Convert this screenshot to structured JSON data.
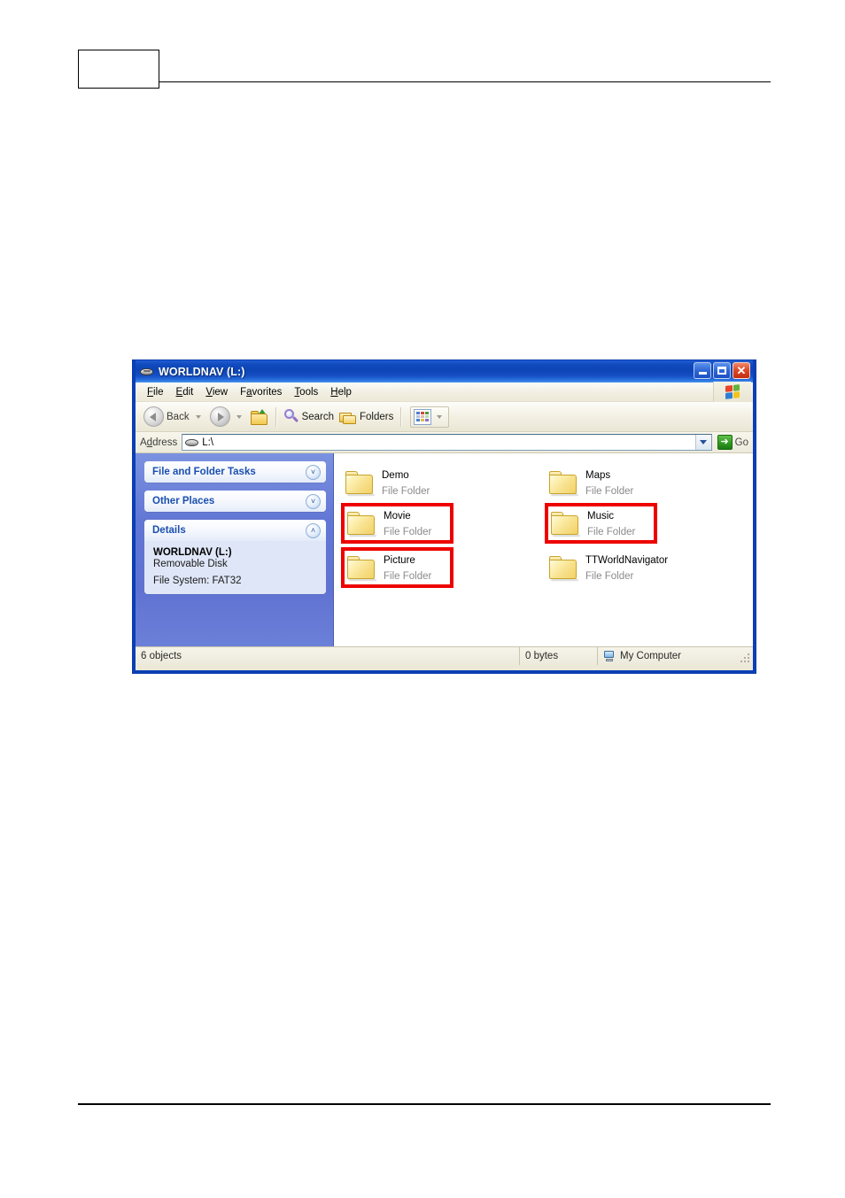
{
  "window": {
    "title": "WORLDNAV (L:)",
    "title_icon": "removable-drive-icon",
    "controls": {
      "minimize": "minimize-button",
      "maximize": "maximize-button",
      "close": "✕"
    }
  },
  "menubar": {
    "items": [
      {
        "label": "File",
        "accel": "F",
        "rest": "ile",
        "pre": ""
      },
      {
        "label": "Edit",
        "accel": "E",
        "rest": "dit",
        "pre": ""
      },
      {
        "label": "View",
        "accel": "V",
        "rest": "iew",
        "pre": ""
      },
      {
        "label": "Favorites",
        "accel": "a",
        "rest": "vorites",
        "pre": "F"
      },
      {
        "label": "Tools",
        "accel": "T",
        "rest": "ools",
        "pre": ""
      },
      {
        "label": "Help",
        "accel": "H",
        "rest": "elp",
        "pre": ""
      }
    ]
  },
  "toolbar": {
    "back_label": "Back",
    "forward_label": "",
    "up_label": "",
    "search_label": "Search",
    "folders_label": "Folders",
    "views_label": ""
  },
  "addressbar": {
    "label": "Address",
    "value": "L:\\",
    "go_label": "Go",
    "go_glyph": "➜"
  },
  "sidebar": {
    "panels": [
      {
        "title": "File and Folder Tasks",
        "chevron": "˅",
        "collapsed": true
      },
      {
        "title": "Other Places",
        "chevron": "˅",
        "collapsed": true
      },
      {
        "title": "Details",
        "chevron": "˄",
        "collapsed": false
      }
    ],
    "details": {
      "name": "WORLDNAV (L:)",
      "kind": "Removable Disk",
      "filesystem": "File System: FAT32"
    }
  },
  "files": {
    "type_label": "File Folder",
    "left_column": [
      {
        "name": "Demo",
        "type": "File Folder",
        "highlighted": false
      },
      {
        "name": "Movie",
        "type": "File Folder",
        "highlighted": true
      },
      {
        "name": "Picture",
        "type": "File Folder",
        "highlighted": true
      }
    ],
    "right_column": [
      {
        "name": "Maps",
        "type": "File Folder",
        "highlighted": false
      },
      {
        "name": "Music",
        "type": "File Folder",
        "highlighted": true
      },
      {
        "name": "TTWorldNavigator",
        "type": "File Folder",
        "highlighted": false
      }
    ]
  },
  "statusbar": {
    "objects": "6 objects",
    "size": "0 bytes",
    "place": "My Computer"
  },
  "colors": {
    "titlebar_blue": "#0d45b6",
    "sidebar_blue": "#6276d4",
    "panel_title": "#1a4fb0",
    "highlight_red": "#ee0000",
    "go_green": "#2f9b22",
    "folder_yellow": "#f7e08a"
  }
}
